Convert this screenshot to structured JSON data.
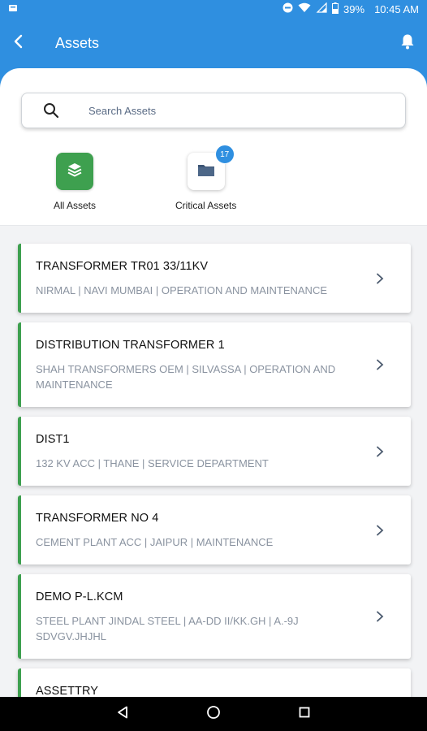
{
  "status_bar": {
    "battery": "39%",
    "time": "10:45 AM"
  },
  "app_bar": {
    "title": "Assets"
  },
  "search": {
    "placeholder": "Search Assets"
  },
  "quick_links": [
    {
      "label": "All Assets"
    },
    {
      "label": "Critical Assets",
      "badge": "17"
    }
  ],
  "assets": [
    {
      "name": "TRANSFORMER TR01 33/11KV",
      "meta": "NIRMAL | NAVI MUMBAI | OPERATION AND MAINTENANCE"
    },
    {
      "name": "DISTRIBUTION TRANSFORMER 1",
      "meta": "SHAH TRANSFORMERS OEM | SILVASSA | OPERATION AND MAINTENANCE"
    },
    {
      "name": "DIST1",
      "meta": "132 KV ACC | THANE | SERVICE DEPARTMENT"
    },
    {
      "name": "TRANSFORMER NO 4",
      "meta": "CEMENT PLANT ACC | JAIPUR | MAINTENANCE"
    },
    {
      "name": "DEMO P-L.KCM",
      "meta": "STEEL PLANT JINDAL STEEL | AA-DD II/KK.GH | A.-9J SDVGV.JHJHL"
    },
    {
      "name": "ASSETTRY",
      "meta": ""
    }
  ],
  "colors": {
    "primary": "#2f8fe0",
    "accent_green": "#3ea04f"
  }
}
